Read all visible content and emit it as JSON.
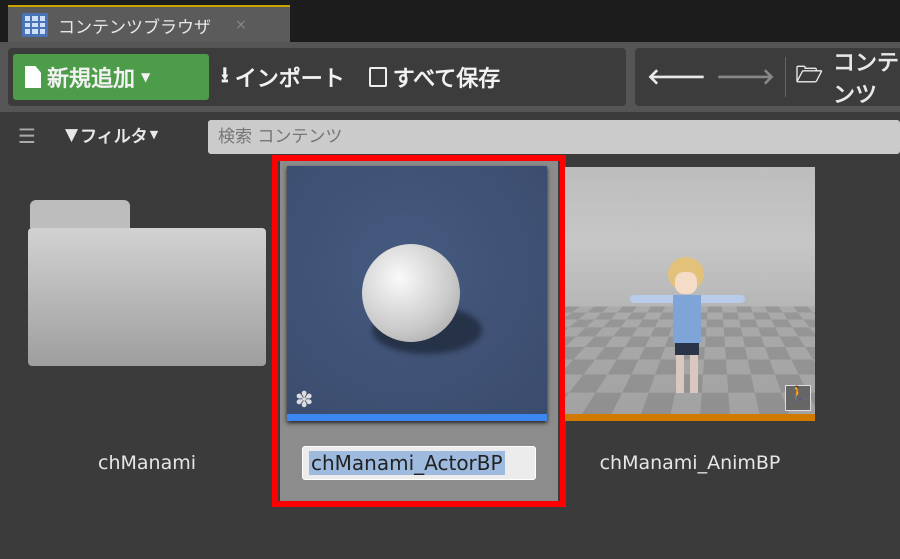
{
  "tab": {
    "title": "コンテンツブラウザ",
    "close": "×"
  },
  "toolbar": {
    "add_new": "新規追加",
    "import": "インポート",
    "save_all": "すべて保存",
    "path": "コンテンツ"
  },
  "filter": {
    "label": "フィルタ",
    "search_placeholder": "検索 コンテンツ"
  },
  "assets": [
    {
      "name": "chManami",
      "type": "folder"
    },
    {
      "name": "chManami_ActorBP",
      "type": "blueprint",
      "selected": true,
      "renaming": true
    },
    {
      "name": "chManami_AnimBP",
      "type": "anim-blueprint"
    }
  ],
  "colors": {
    "accent_green": "#4d9c4a",
    "selection": "#ff0000",
    "blueprint_bar": "#3c86f0",
    "anim_bar": "#d07a00"
  }
}
